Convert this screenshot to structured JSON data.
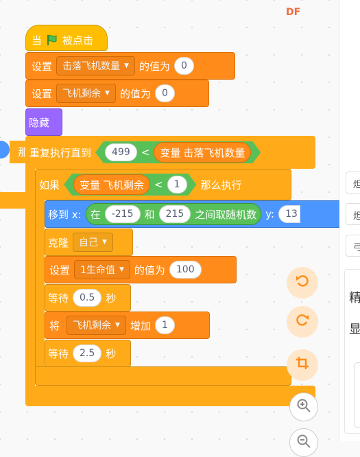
{
  "watermark": "DF",
  "right_panel": {
    "items": [
      "炟",
      "炟",
      "弓"
    ],
    "labels": [
      "精",
      "显"
    ]
  },
  "script": {
    "hat": {
      "when": "当",
      "event": "被点击",
      "flag_icon": "green-flag-icon"
    },
    "set_hits": {
      "label": "设置",
      "variable": "击落飞机数量",
      "suffix": "的值为",
      "value": "0"
    },
    "set_remaining": {
      "label": "设置",
      "variable": "飞机剩余",
      "suffix": "的值为",
      "value": "0"
    },
    "hide": {
      "label": "隐藏"
    },
    "repeat_until": {
      "label": "重复执行直到",
      "left_value": "499",
      "operator": "<",
      "variable_label": "变量",
      "variable": "击落飞机数量"
    },
    "if_block": {
      "label": "如果",
      "variable_label": "变量",
      "variable": "飞机剩余",
      "operator": "<",
      "value": "1",
      "then": "那么执行"
    },
    "goto": {
      "label": "移到 x:",
      "random_prefix": "在",
      "from": "-215",
      "and": "和",
      "to": "215",
      "random_suffix": "之间取随机数",
      "y_label": "y:",
      "y_value": "13"
    },
    "clone": {
      "label": "克隆",
      "target": "自己"
    },
    "set_life": {
      "label": "设置",
      "variable": "1生命值",
      "suffix": "的值为",
      "value": "100"
    },
    "wait1": {
      "label": "等待",
      "value": "0.5",
      "unit": "秒"
    },
    "change_remaining": {
      "label": "将",
      "variable": "飞机剩余",
      "action": "增加",
      "value": "1"
    },
    "wait2": {
      "label": "等待",
      "value": "2.5",
      "unit": "秒"
    },
    "offscreen_label": "那"
  },
  "controls": {
    "undo_icon": "undo-icon",
    "redo_icon": "redo-icon",
    "crop_icon": "crop-icon",
    "zoom_in_icon": "zoom-in-icon",
    "zoom_out_icon": "zoom-out-icon"
  },
  "colors": {
    "events": "#ffbf00",
    "variables": "#ff8c1a",
    "looks": "#9966ff",
    "control": "#ffab19",
    "motion": "#4c97ff",
    "operators": "#59c059"
  }
}
